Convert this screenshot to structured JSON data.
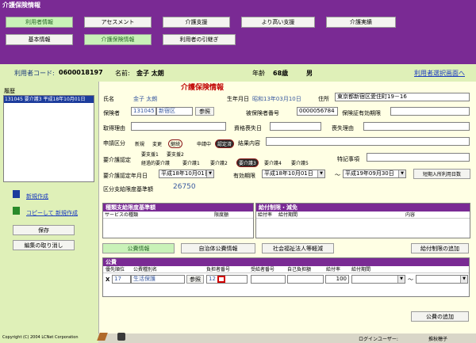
{
  "window": {
    "title": "介護保険情報"
  },
  "top_tabs": [
    {
      "label": "利用者情報",
      "active": true
    },
    {
      "label": "アセスメント",
      "active": false
    },
    {
      "label": "介護支援",
      "active": false
    },
    {
      "label": "より高い支援",
      "active": false
    },
    {
      "label": "介護実績",
      "active": false
    }
  ],
  "sub_tabs": [
    {
      "label": "基本情報",
      "active": false
    },
    {
      "label": "介護保険情報",
      "active": true
    },
    {
      "label": "利用者の引継ぎ",
      "active": false
    }
  ],
  "header": {
    "code_label": "利用者コード:",
    "code_value": "0600018197",
    "name_label": "名前:",
    "name_value": "金子  太朗",
    "age_label": "年齢",
    "age_value": "68歳",
    "gender": "男",
    "select_link": "利用者選択画面へ"
  },
  "left": {
    "history_label": "履歴",
    "history_item": "131045 要介護3 平成18年10月01日",
    "new_link": "新規作成",
    "copy_link": "コピーして 新規作成",
    "save_button": "保存",
    "cancel_button": "編集の取り消し",
    "copyright": "Copyright (C) 2004 LCNet Corporation"
  },
  "form": {
    "title": "介護保険情報",
    "name_label": "氏名",
    "name_value": "金子  太朗",
    "birth_label": "生年月日",
    "birth_value": "昭和13年03月10日",
    "address_label": "住所",
    "address_value": "東京都新宿区愛住町19－16",
    "insurer_label": "保険者",
    "insurer_code": "131045",
    "insurer_name": "新宿区",
    "ref_button": "参照",
    "insured_no_label": "被保険者番号",
    "insured_no_value": "0000056784",
    "cert_expiry_label": "保険証有効期限",
    "acquire_reason_label": "取得理由",
    "loss_date_label": "資格喪失日",
    "loss_reason_label": "喪失理由",
    "apply_label": "申請区分",
    "apply_opts": [
      "新規",
      "変更",
      "継続"
    ],
    "apply_selected": "継続",
    "status_label": "申請中",
    "status_value": "認定済",
    "result_label": "結果内容",
    "care_label": "要介護認定",
    "care_row1": [
      "要支援1",
      "要支援2"
    ],
    "care_row2": [
      "経過的要介護",
      "要介護1",
      "要介護2",
      "要介護3",
      "要介護4",
      "要介護5"
    ],
    "care_selected": "要介護3",
    "special_label": "特記事項",
    "cert_date_label": "要介護認定年月日",
    "cert_date_value": "平成18年10月01日",
    "valid_label": "有効期限",
    "valid_from": "平成18年10月01日",
    "tilde": "～",
    "valid_to": "平成19年09月30日",
    "short_stay_button": "短期入所利用日数",
    "limit_label": "区分支給限度基準額",
    "limit_value": "26750"
  },
  "service_panel": {
    "title": "種類支給限度基準額",
    "col1": "サービスの種類",
    "col2": "限度額"
  },
  "restrict_panel": {
    "title": "給付制限・減免",
    "col1": "給付率",
    "col2": "給付期間",
    "col3": "内容"
  },
  "bottom_buttons": {
    "public": "公費情報",
    "local": "自治体公費情報",
    "welfare": "社会福祉法人等軽減",
    "add_restrict": "給付制限の追加",
    "add_public": "公費の追加"
  },
  "public_panel": {
    "title": "公費",
    "headers": [
      "優先順位",
      "公費種別名",
      "負担者番号",
      "受給者番号",
      "自己負担額",
      "給付率",
      "給付期間"
    ],
    "row": {
      "x": "X",
      "priority": "17",
      "type": "生活保護",
      "ref": "参照",
      "payer": "12",
      "rate": "100",
      "tilde": "～"
    }
  },
  "status": {
    "login_label": "ログインユーザー:",
    "login_user": "推秋穂子"
  },
  "colors": {
    "purple": "#7a2a94",
    "green": "#dff0b8",
    "formbg": "#ffffe4",
    "accent_red": "#c00000"
  }
}
